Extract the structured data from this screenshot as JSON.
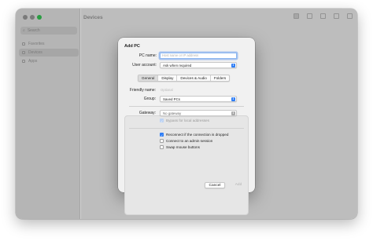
{
  "window": {
    "title": "Devices",
    "sidebar": {
      "search_placeholder": "Search",
      "items": [
        {
          "label": "Favorites"
        },
        {
          "label": "Devices"
        },
        {
          "label": "Apps"
        }
      ]
    }
  },
  "dialog": {
    "title": "Add PC",
    "pc_name": {
      "label": "PC name:",
      "placeholder": "Host name or IP address"
    },
    "user_account": {
      "label": "User account:",
      "value": "Ask when required"
    },
    "tabs": [
      {
        "label": "General",
        "selected": true
      },
      {
        "label": "Display",
        "selected": false
      },
      {
        "label": "Devices & Audio",
        "selected": false
      },
      {
        "label": "Folders",
        "selected": false
      }
    ],
    "friendly_name": {
      "label": "Friendly name:",
      "placeholder": "Optional"
    },
    "group": {
      "label": "Group:",
      "value": "Saved PCs"
    },
    "gateway": {
      "label": "Gateway:",
      "value": "No gateway"
    },
    "bypass": {
      "label": "Bypass for local addresses",
      "checked": true,
      "enabled": false
    },
    "reconnect": {
      "label": "Reconnect if the connection is dropped",
      "checked": true
    },
    "admin_session": {
      "label": "Connect to an admin session",
      "checked": false
    },
    "swap_mouse": {
      "label": "Swap mouse buttons",
      "checked": false
    },
    "cancel_label": "Cancel",
    "add_label": "Add"
  },
  "colors": {
    "accent": "#2f7ef5",
    "traffic_green": "#2fb34a"
  }
}
